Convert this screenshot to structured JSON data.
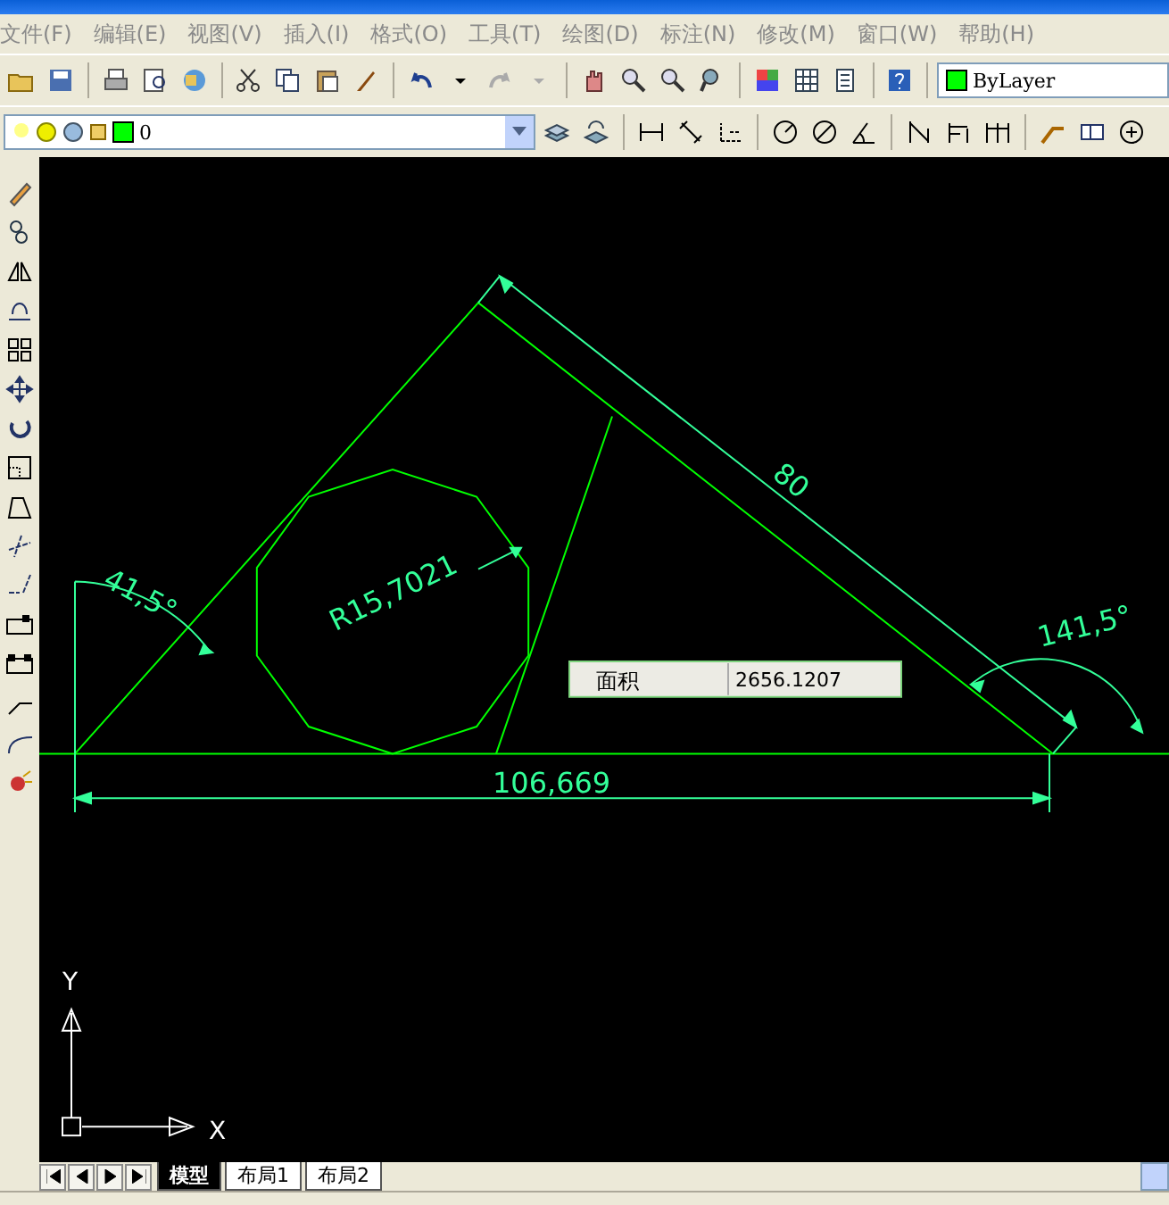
{
  "menu": [
    {
      "label": "文件(F)"
    },
    {
      "label": "编辑(E)"
    },
    {
      "label": "视图(V)"
    },
    {
      "label": "插入(I)"
    },
    {
      "label": "格式(O)"
    },
    {
      "label": "工具(T)"
    },
    {
      "label": "绘图(D)"
    },
    {
      "label": "标注(N)"
    },
    {
      "label": "修改(M)"
    },
    {
      "label": "窗口(W)"
    },
    {
      "label": "帮助(H)"
    }
  ],
  "color_control": {
    "value": "ByLayer"
  },
  "layer_control": {
    "value": "0"
  },
  "dimension_labels": [
    "41,5°",
    "R15,7021",
    "80",
    "141,5°",
    "106,669"
  ],
  "tooltip": {
    "label": "面积",
    "value": "2656.1207"
  },
  "ucs": {
    "y_label": "Y",
    "x_label": "X"
  },
  "tabs": [
    {
      "label": "模型",
      "selected": true
    },
    {
      "label": "布局1",
      "selected": false
    },
    {
      "label": "布局2",
      "selected": false
    }
  ]
}
